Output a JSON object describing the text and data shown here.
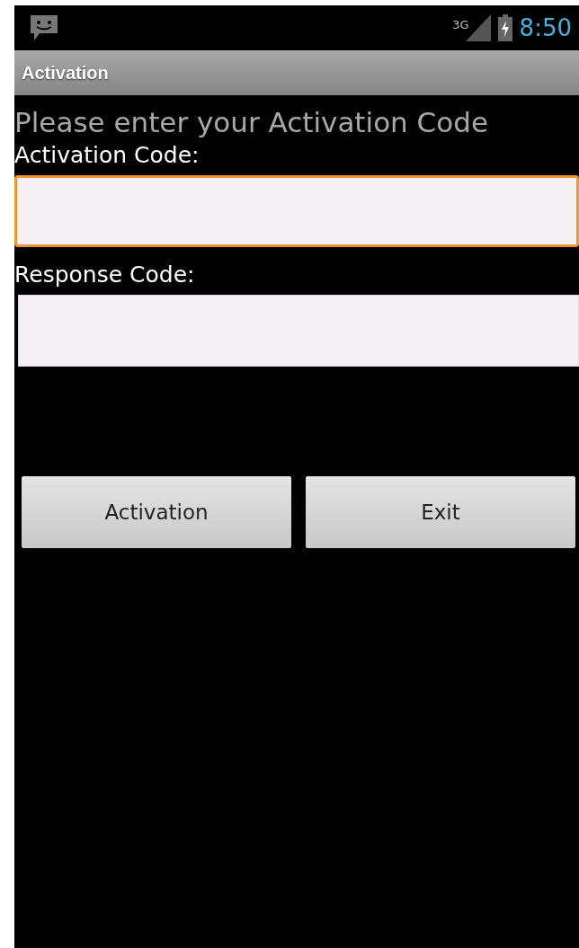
{
  "status_bar": {
    "network": "3G",
    "time": "8:50"
  },
  "title_bar": {
    "title": "Activation"
  },
  "heading": "Please enter your Activation Code",
  "fields": [
    {
      "label": "Activation Code:",
      "focused": true
    },
    {
      "label": "Response Code:",
      "focused": false
    }
  ],
  "buttons": [
    "Activation",
    "Exit"
  ]
}
